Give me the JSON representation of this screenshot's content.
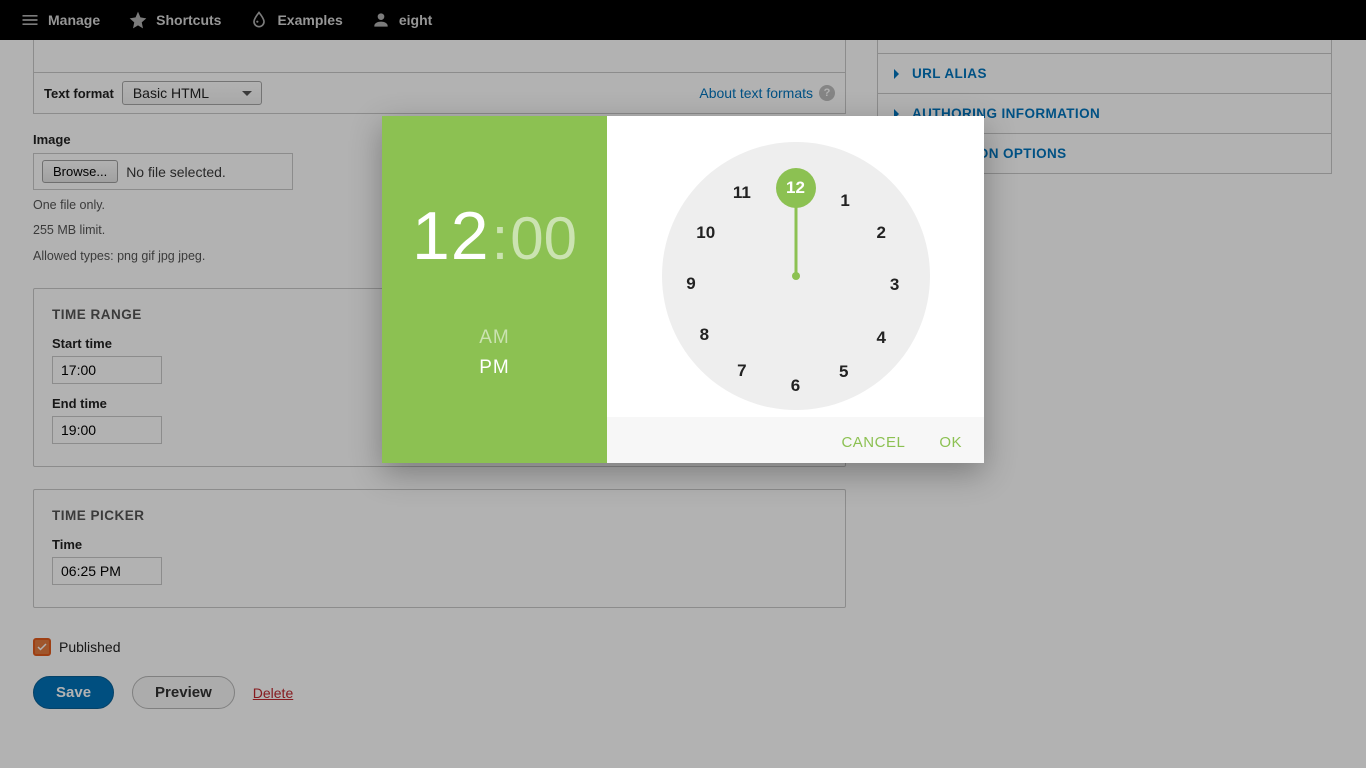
{
  "toolbar": {
    "manage": "Manage",
    "shortcuts": "Shortcuts",
    "examples": "Examples",
    "user": "eight"
  },
  "format": {
    "label": "Text format",
    "selected": "Basic HTML",
    "about": "About text formats"
  },
  "image": {
    "label": "Image",
    "browse": "Browse...",
    "no_file": "No file selected.",
    "hint1": "One file only.",
    "hint2": "255 MB limit.",
    "hint3": "Allowed types: png gif jpg jpeg."
  },
  "timerange": {
    "title": "TIME RANGE",
    "start_label": "Start time",
    "start_value": "17:00",
    "end_label": "End time",
    "end_value": "19:00"
  },
  "timepicker": {
    "title": "TIME PICKER",
    "time_label": "Time",
    "time_value": "06:25 PM"
  },
  "published": "Published",
  "buttons": {
    "save": "Save",
    "preview": "Preview",
    "delete": "Delete"
  },
  "sidebar": {
    "items": [
      "URL ALIAS",
      "AUTHORING INFORMATION",
      "PROMOTION OPTIONS"
    ]
  },
  "dialog": {
    "hour": "12",
    "minute": "00",
    "am": "AM",
    "pm": "PM",
    "cancel": "CANCEL",
    "ok": "OK",
    "numbers": [
      "12",
      "1",
      "2",
      "3",
      "4",
      "5",
      "6",
      "7",
      "8",
      "9",
      "10",
      "11"
    ]
  }
}
